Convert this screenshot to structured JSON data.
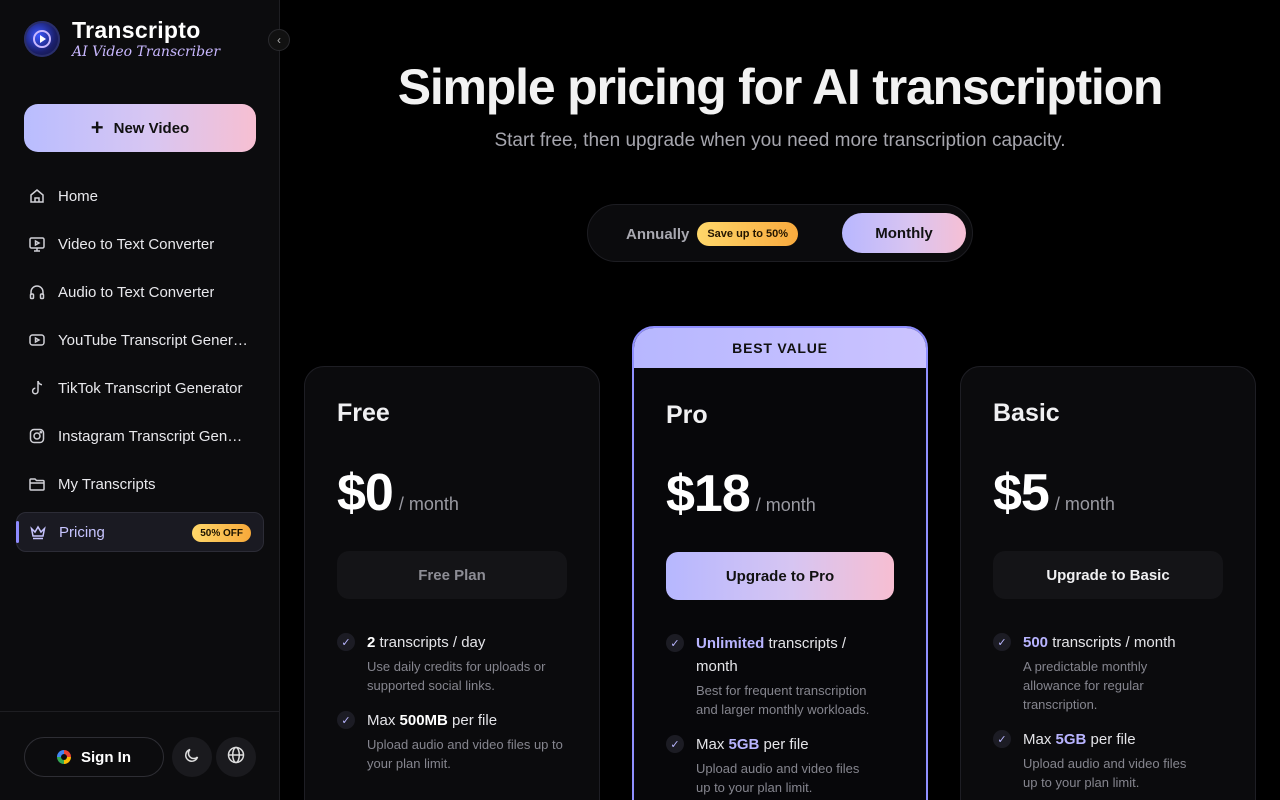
{
  "brand": {
    "name": "Transcripto",
    "subtitle": "AI Video Transcriber"
  },
  "sidebar": {
    "new_video_label": "New Video",
    "items": [
      {
        "label": "Home",
        "icon": "home-icon"
      },
      {
        "label": "Video to Text Converter",
        "icon": "monitor-play-icon"
      },
      {
        "label": "Audio to Text Converter",
        "icon": "headphones-icon"
      },
      {
        "label": "YouTube Transcript Generator",
        "icon": "youtube-icon"
      },
      {
        "label": "TikTok Transcript Generator",
        "icon": "tiktok-icon"
      },
      {
        "label": "Instagram Transcript Generator",
        "icon": "instagram-icon"
      },
      {
        "label": "My Transcripts",
        "icon": "folder-icon"
      },
      {
        "label": "Pricing",
        "icon": "crown-icon",
        "badge": "50% OFF",
        "active": true
      }
    ],
    "signin_label": "Sign In"
  },
  "hero": {
    "title": "Simple pricing for AI transcription",
    "subtitle": "Start free, then upgrade when you need more transcription capacity."
  },
  "billing_toggle": {
    "annual_label": "Annually",
    "annual_badge": "Save up to 50%",
    "monthly_label": "Monthly",
    "selected": "Monthly"
  },
  "plans": {
    "free": {
      "name": "Free",
      "price": "$0",
      "period": "/ month",
      "button": "Free Plan",
      "features": [
        {
          "value": "2",
          "text": " transcripts / day",
          "desc": "Use daily credits for uploads or supported social links."
        },
        {
          "prefix": "Max ",
          "value": "500MB",
          "text": " per file",
          "desc": "Upload audio and video files up to your plan limit."
        }
      ]
    },
    "pro": {
      "banner": "BEST VALUE",
      "name": "Pro",
      "price": "$18",
      "period": "/ month",
      "button": "Upgrade to Pro",
      "features": [
        {
          "value": "Unlimited",
          "text": " transcripts / month",
          "desc": "Best for frequent transcription and larger monthly workloads."
        },
        {
          "prefix": "Max ",
          "value": "5GB",
          "text": " per file",
          "desc": "Upload audio and video files up to your plan limit."
        }
      ]
    },
    "basic": {
      "name": "Basic",
      "price": "$5",
      "period": "/ month",
      "button": "Upgrade to Basic",
      "features": [
        {
          "value": "500",
          "text": " transcripts / month",
          "desc": "A predictable monthly allowance for regular transcription."
        },
        {
          "prefix": "Max ",
          "value": "5GB",
          "text": " per file",
          "desc": "Upload audio and video files up to your plan limit."
        }
      ]
    }
  },
  "colors": {
    "accent": "#b8b7ff",
    "badge": "#ffd76a",
    "background": "#000000"
  }
}
